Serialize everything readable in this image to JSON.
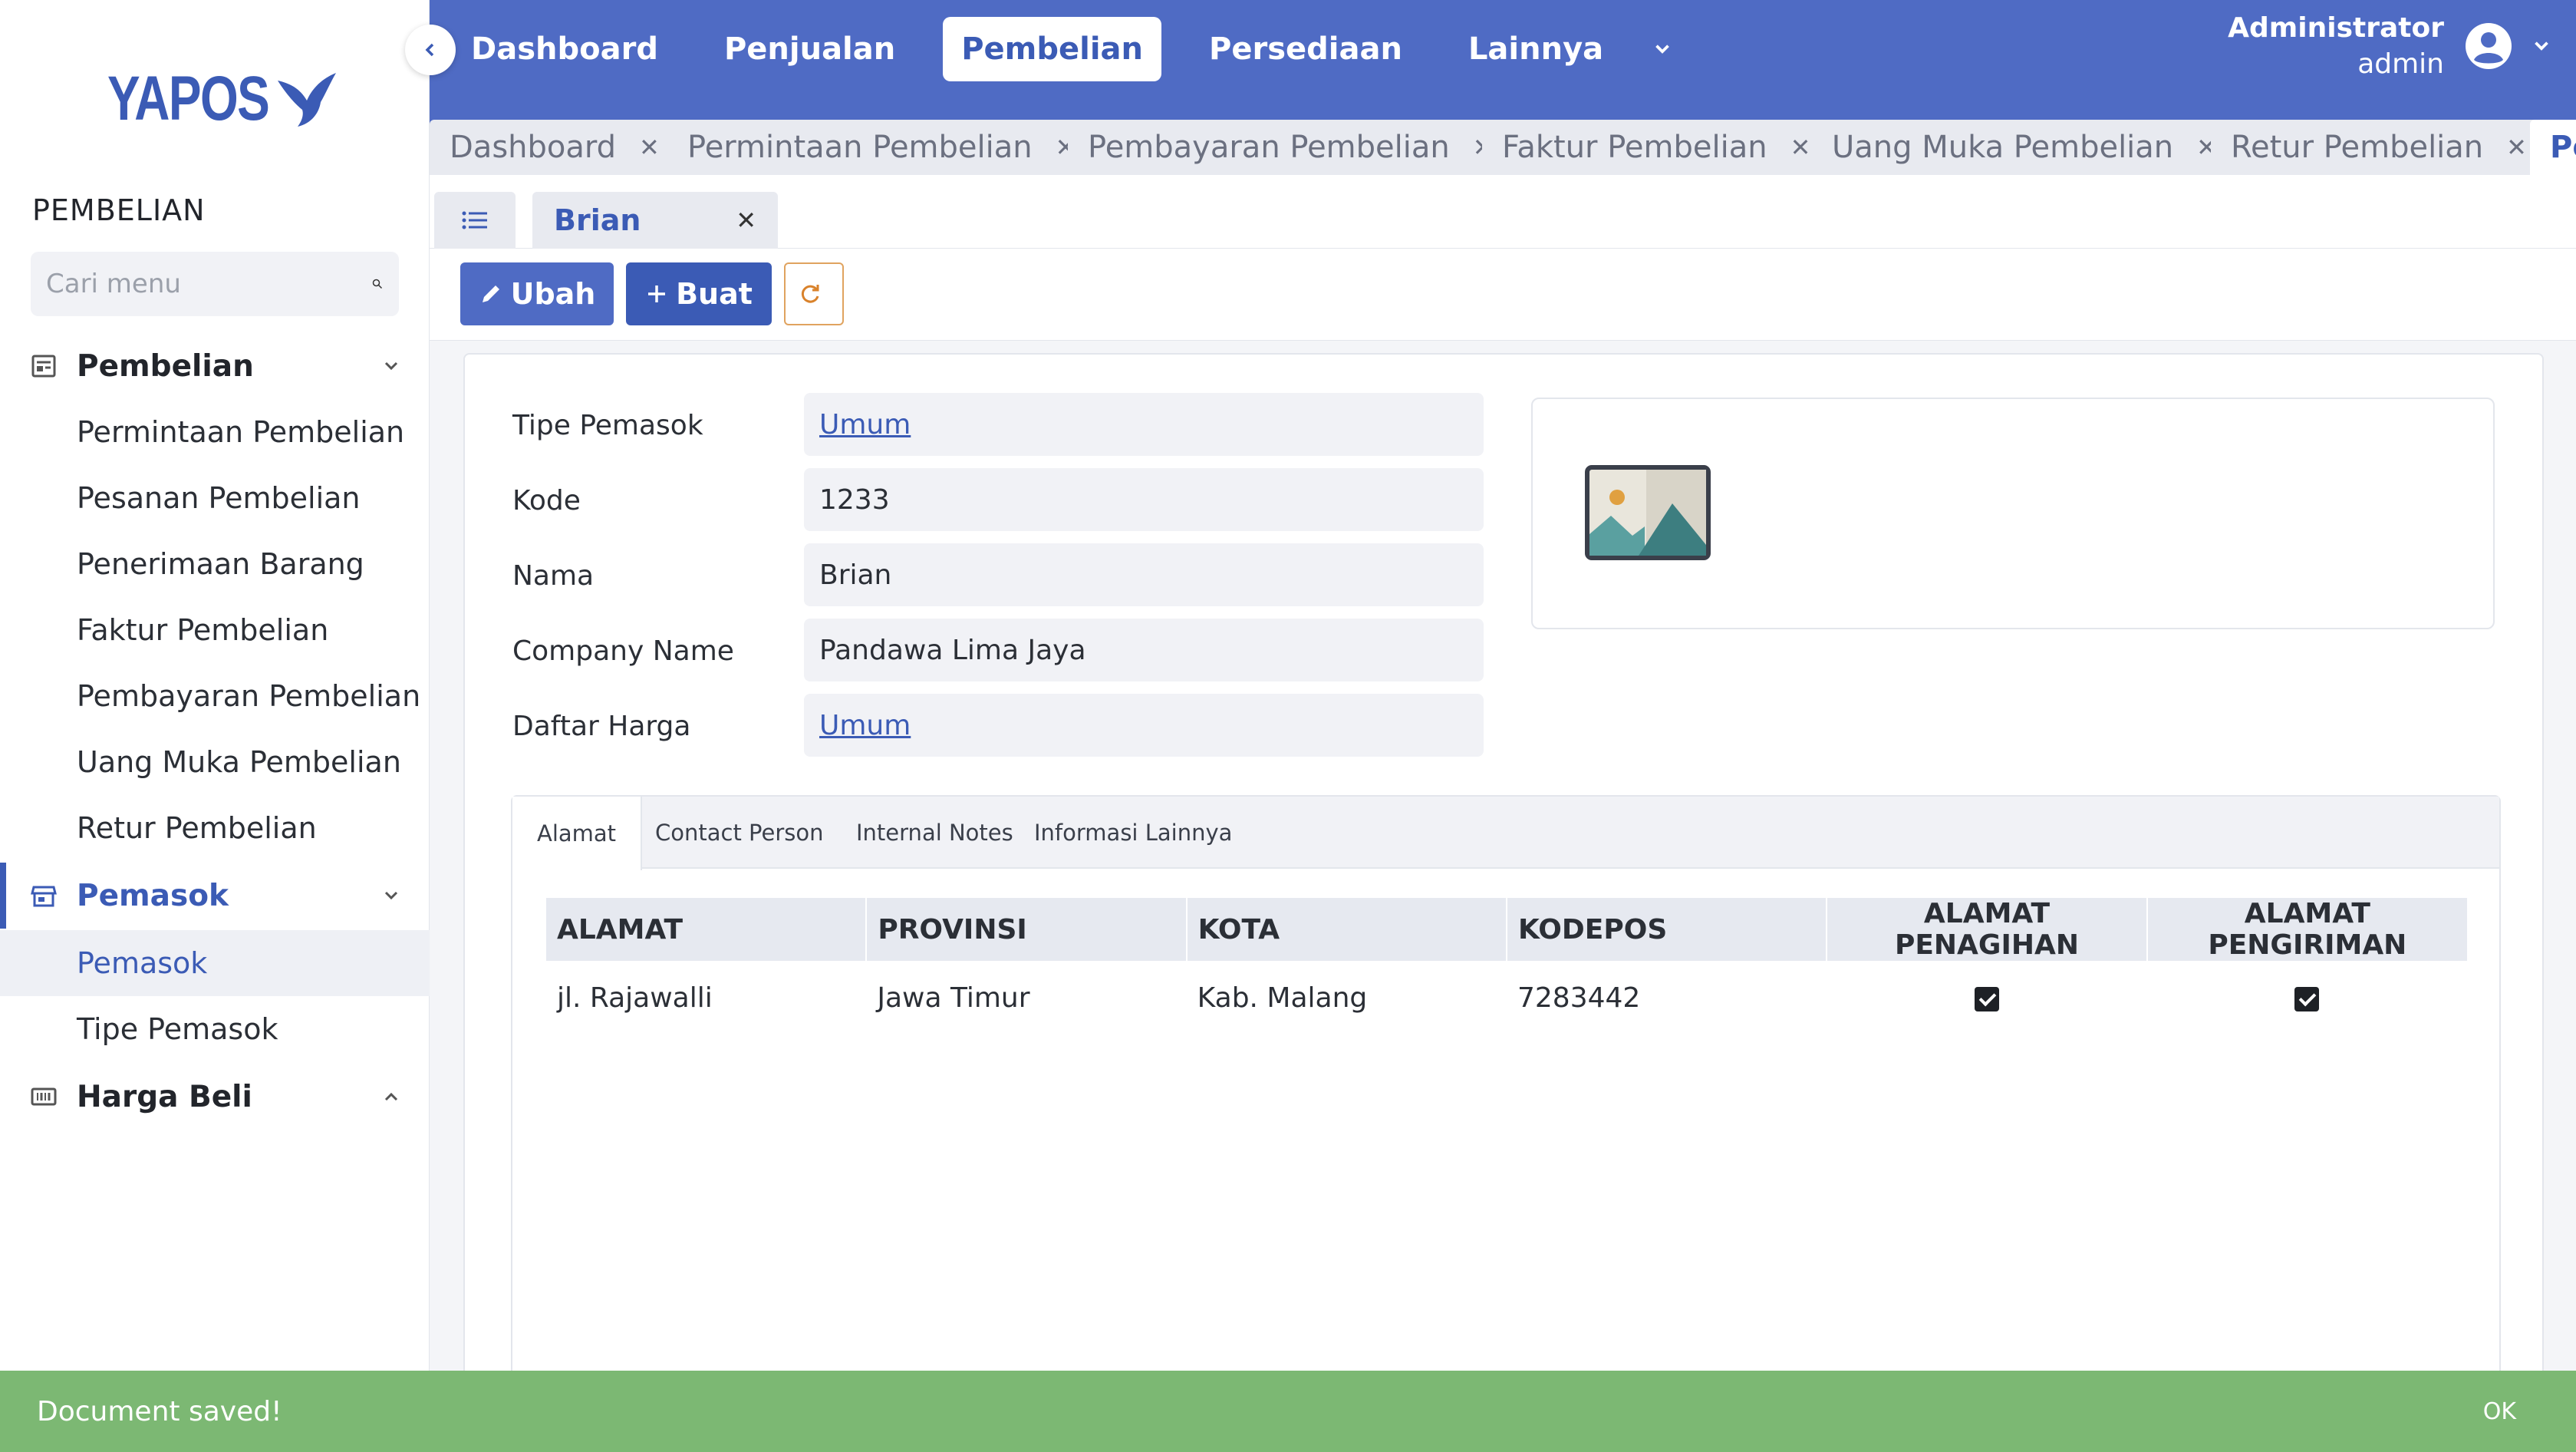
{
  "app": {
    "logo": "YAPOS",
    "brand_color": "#3b5bb5",
    "accent_color": "#4f6bc4"
  },
  "sidebar": {
    "section_title": "PEMBELIAN",
    "search_placeholder": "Cari menu",
    "groups": [
      {
        "label": "Pembelian",
        "icon": "document-list-icon",
        "expanded": true,
        "items": [
          "Permintaan Pembelian",
          "Pesanan Pembelian",
          "Penerimaan Barang",
          "Faktur Pembelian",
          "Pembayaran Pembelian",
          "Uang Muka Pembelian",
          "Retur Pembelian"
        ]
      },
      {
        "label": "Pemasok",
        "icon": "store-icon",
        "expanded": true,
        "active": true,
        "items": [
          "Pemasok",
          "Tipe Pemasok"
        ]
      },
      {
        "label": "Harga Beli",
        "icon": "barcode-icon",
        "expanded": false,
        "items": []
      }
    ],
    "selected_item": "Pemasok"
  },
  "topnav": {
    "items": [
      "Dashboard",
      "Penjualan",
      "Pembelian",
      "Persediaan",
      "Lainnya"
    ],
    "active": "Pembelian"
  },
  "user": {
    "name": "Administrator",
    "role": "admin"
  },
  "doc_tabs": [
    "Dashboard",
    "Permintaan Pembelian",
    "Pembayaran Pembelian",
    "Faktur Pembelian",
    "Uang Muka Pembelian",
    "Retur Pembelian",
    "Pe"
  ],
  "record_tab": {
    "label": "Brian"
  },
  "toolbar": {
    "edit_label": "Ubah",
    "create_label": "Buat"
  },
  "form": {
    "fields": [
      {
        "label": "Tipe Pemasok",
        "value": "Umum",
        "link": true
      },
      {
        "label": "Kode",
        "value": "1233",
        "link": false
      },
      {
        "label": "Nama",
        "value": "Brian",
        "link": false
      },
      {
        "label": "Company Name",
        "value": "Pandawa Lima Jaya",
        "link": false
      },
      {
        "label": "Daftar Harga",
        "value": "Umum",
        "link": true
      }
    ]
  },
  "detail_tabs": [
    "Alamat",
    "Contact Person",
    "Internal Notes",
    "Informasi Lainnya"
  ],
  "address_table": {
    "headers": [
      "ALAMAT",
      "PROVINSI",
      "KOTA",
      "KODEPOS",
      "ALAMAT PENAGIHAN",
      "ALAMAT PENGIRIMAN"
    ],
    "rows": [
      {
        "alamat": "jl. Rajawalli",
        "provinsi": "Jawa Timur",
        "kota": "Kab. Malang",
        "kodepos": "7283442",
        "penagihan": true,
        "pengiriman": true
      }
    ]
  },
  "toast": {
    "message": "Document saved!",
    "action": "OK",
    "color": "#7cb873"
  }
}
